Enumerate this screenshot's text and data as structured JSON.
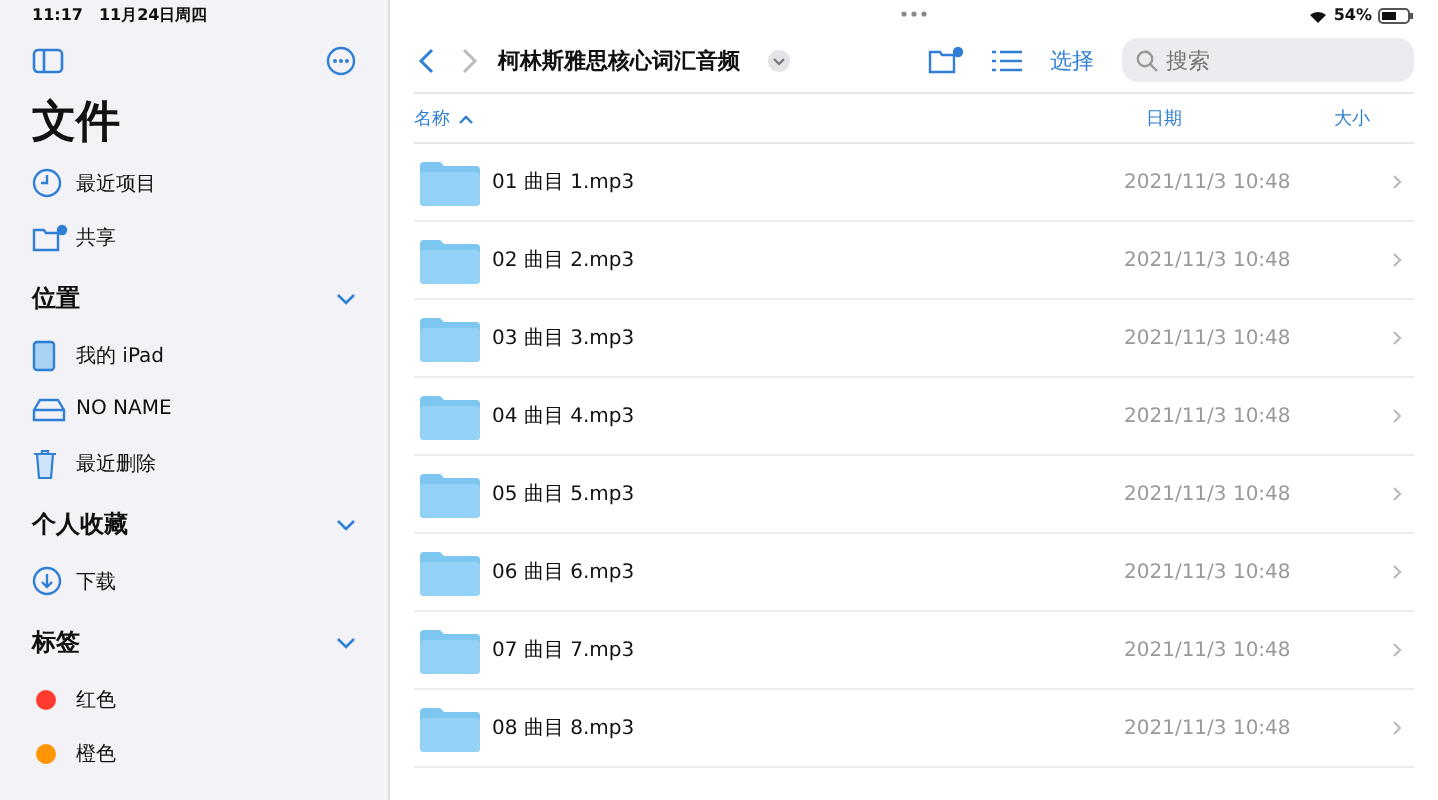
{
  "status_bar": {
    "time": "11:17",
    "date": "11月24日周四",
    "battery": "54%"
  },
  "sidebar": {
    "title": "文件",
    "items": [
      {
        "kind": "clock",
        "label": "最近项目"
      },
      {
        "kind": "shared",
        "label": "共享"
      }
    ],
    "sections": [
      {
        "title": "位置",
        "expanded": true,
        "items": [
          {
            "kind": "ipad",
            "label": "我的 iPad"
          },
          {
            "kind": "drive",
            "label": "NO NAME"
          },
          {
            "kind": "trash",
            "label": "最近删除"
          }
        ]
      },
      {
        "title": "个人收藏",
        "expanded": true,
        "items": [
          {
            "kind": "download",
            "label": "下载"
          }
        ]
      },
      {
        "title": "标签",
        "expanded": true,
        "items": [
          {
            "kind": "tag",
            "label": "红色",
            "color": "#ff3b30"
          },
          {
            "kind": "tag",
            "label": "橙色",
            "color": "#ff9500"
          }
        ]
      }
    ]
  },
  "toolbar": {
    "folder_title": "柯林斯雅思核心词汇音频",
    "select": "选择",
    "search": {
      "placeholder": "搜索"
    }
  },
  "table": {
    "columns": [
      {
        "label": "名称",
        "sorted": true
      },
      {
        "label": "日期",
        "sorted": false
      },
      {
        "label": "大小",
        "sorted": false
      }
    ],
    "rows": [
      {
        "name": "01 曲目 1.mp3",
        "date": "2021/11/3 10:48"
      },
      {
        "name": "02 曲目 2.mp3",
        "date": "2021/11/3 10:48"
      },
      {
        "name": "03 曲目 3.mp3",
        "date": "2021/11/3 10:48"
      },
      {
        "name": "04 曲目 4.mp3",
        "date": "2021/11/3 10:48"
      },
      {
        "name": "05 曲目 5.mp3",
        "date": "2021/11/3 10:48"
      },
      {
        "name": "06 曲目 6.mp3",
        "date": "2021/11/3 10:48"
      },
      {
        "name": "07 曲目 7.mp3",
        "date": "2021/11/3 10:48"
      },
      {
        "name": "08 曲目 8.mp3",
        "date": "2021/11/3 10:48"
      }
    ]
  }
}
